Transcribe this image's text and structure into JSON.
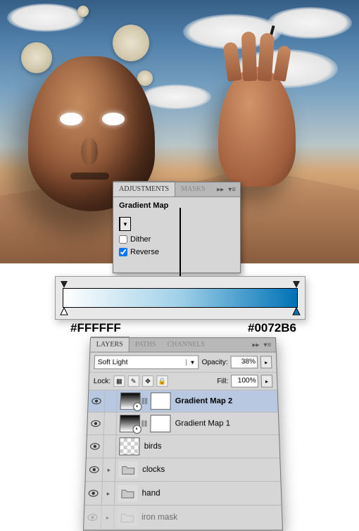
{
  "adjustments": {
    "tab_adjustments": "ADJUSTMENTS",
    "tab_masks": "MASKS",
    "title": "Gradient Map",
    "dither_label": "Dither",
    "dither_checked": false,
    "reverse_label": "Reverse",
    "reverse_checked": true
  },
  "gradient": {
    "left_hex": "#FFFFFF",
    "right_hex": "#0072B6"
  },
  "layers": {
    "tab_layers": "LAYERS",
    "tab_paths": "PATHS",
    "tab_channels": "CHANNELS",
    "blend_mode": "Soft Light",
    "opacity_label": "Opacity:",
    "opacity_value": "38%",
    "lock_label": "Lock:",
    "fill_label": "Fill:",
    "fill_value": "100%",
    "items": [
      {
        "name": "Gradient Map 2"
      },
      {
        "name": "Gradient Map 1"
      },
      {
        "name": "birds"
      },
      {
        "name": "clocks"
      },
      {
        "name": "hand"
      },
      {
        "name": "iron mask"
      }
    ]
  }
}
